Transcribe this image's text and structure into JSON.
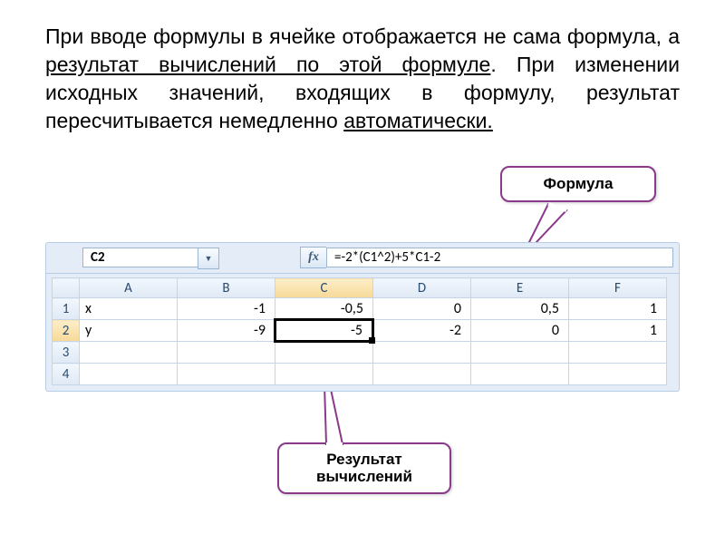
{
  "text": {
    "p1a": "При вводе формулы в ячейке отображается не сама формула, а ",
    "p1u": "результат вычислений по этой формуле",
    "p1b": ". При изменении исходных значений, входящих в формулу, результат пересчитывается немедленно ",
    "p1c": "автоматически."
  },
  "callouts": {
    "formula": "Формула",
    "result_l1": "Результат",
    "result_l2": "вычислений"
  },
  "colors": {
    "callout_border": "#8b3a8b"
  },
  "excel": {
    "namebox": "C2",
    "fx_label": "fx",
    "formula": "=-2*(C1^2)+5*C1-2",
    "columns": [
      "A",
      "B",
      "C",
      "D",
      "E",
      "F"
    ],
    "row_headers": [
      "1",
      "2",
      "3",
      "4"
    ],
    "active": {
      "col": "C",
      "row": "2"
    },
    "cells": {
      "r1": {
        "A": "x",
        "B": "-1",
        "C": "-0,5",
        "D": "0",
        "E": "0,5",
        "F": "1"
      },
      "r2": {
        "A": "y",
        "B": "-9",
        "C": "-5",
        "D": "-2",
        "E": "0",
        "F": "1"
      },
      "r3": {
        "A": "",
        "B": "",
        "C": "",
        "D": "",
        "E": "",
        "F": ""
      },
      "r4": {
        "A": "",
        "B": "",
        "C": "",
        "D": "",
        "E": "",
        "F": ""
      }
    }
  }
}
